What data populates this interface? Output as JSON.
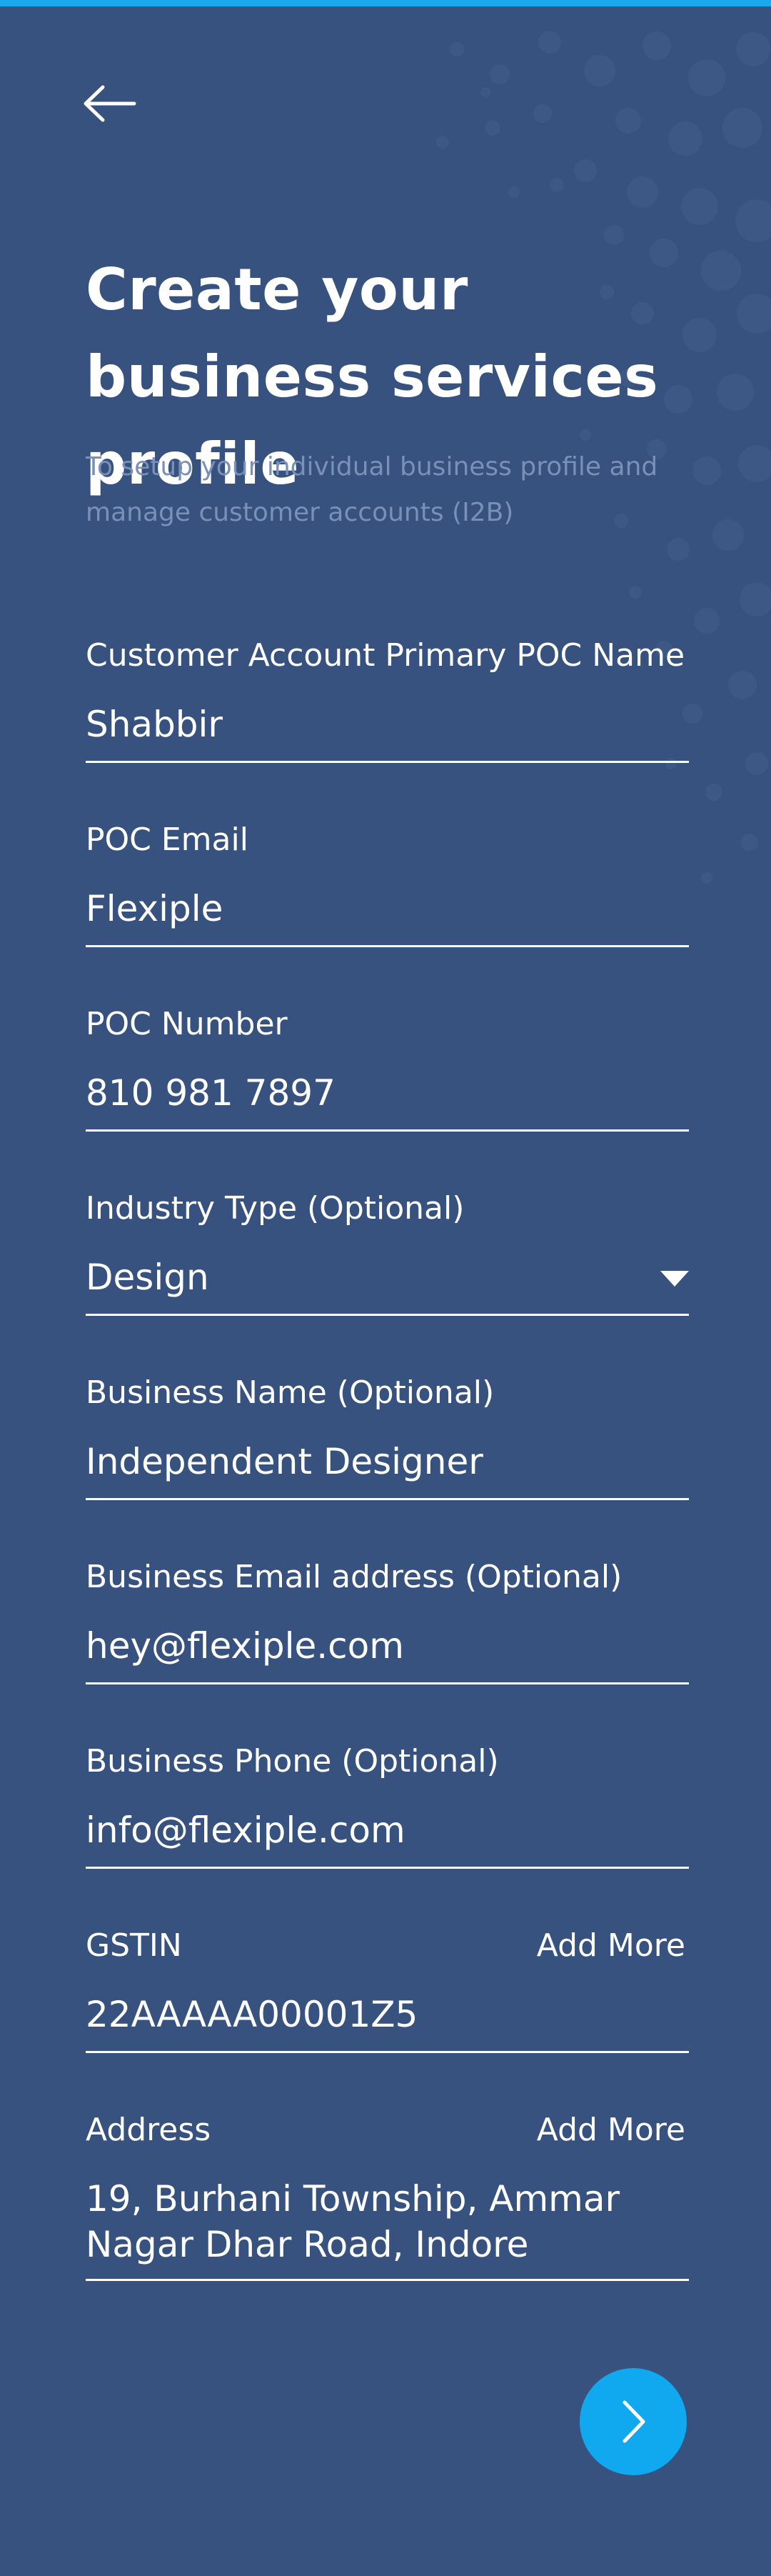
{
  "header": {
    "back_icon": "arrow-left-icon",
    "title": "Create your business services profile",
    "subtitle": "To setup your individual business profile and manage customer accounts (I2B)"
  },
  "form": {
    "fields": [
      {
        "label": "Customer Account Primary POC Name",
        "value": "Shabbir"
      },
      {
        "label": "POC Email",
        "value": "Flexiple"
      },
      {
        "label": "POC Number",
        "value": "810 981 7897"
      },
      {
        "label": "Industry Type (Optional)",
        "value": "Design",
        "control": "dropdown"
      },
      {
        "label": "Business Name (Optional)",
        "value": "Independent Designer"
      },
      {
        "label": "Business Email address (Optional)",
        "value": "hey@flexiple.com"
      },
      {
        "label": "Business Phone (Optional)",
        "value": "info@flexiple.com"
      },
      {
        "label": "GSTIN",
        "value": "22AAAAA00001Z5",
        "action": "Add More"
      },
      {
        "label": "Address",
        "value": "19, Burhani Township, Ammar\nNagar Dhar Road, Indore",
        "action": "Add More"
      }
    ]
  },
  "next_button": {
    "icon": "chevron-right-icon"
  },
  "colors": {
    "background": "#38527f",
    "accent": "#1aa9ec",
    "subtitle": "#7990b8",
    "text": "#ffffff"
  }
}
